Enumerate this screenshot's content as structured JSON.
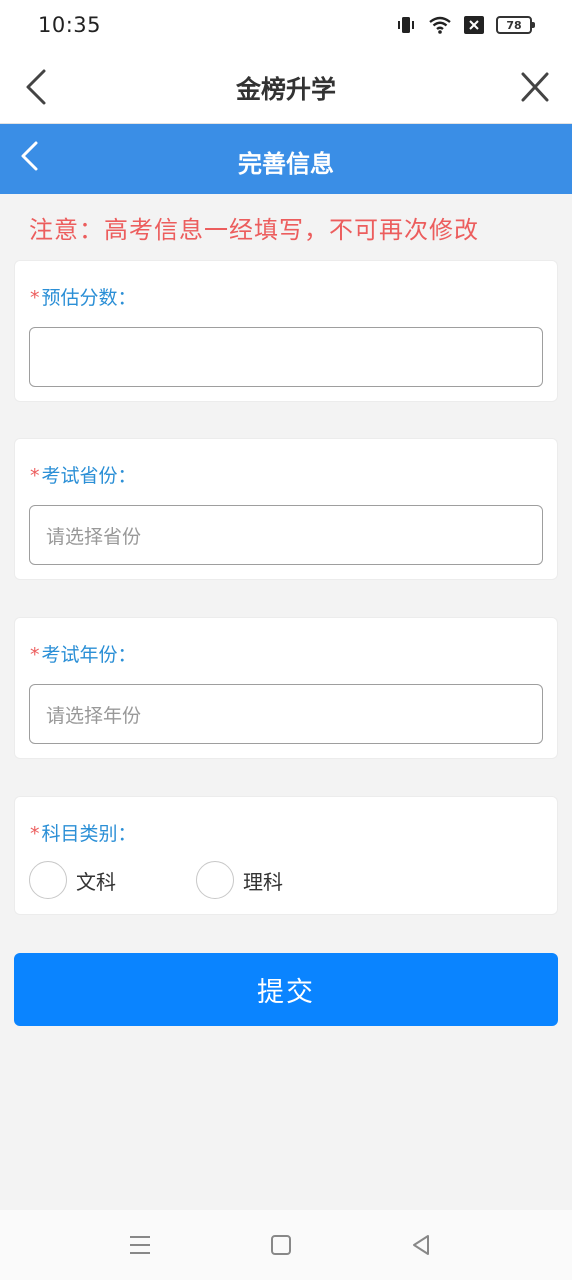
{
  "status_bar": {
    "time": "10:35",
    "battery": "78",
    "icons": [
      "vibrate-icon",
      "wifi-icon",
      "sim-x-icon",
      "battery-icon"
    ]
  },
  "app_nav": {
    "title": "金榜升学",
    "icons": [
      "back-icon",
      "close-icon"
    ]
  },
  "page_header": {
    "title": "完善信息",
    "background": "#3a8ee6"
  },
  "notice": "注意：高考信息一经填写，不可再次修改",
  "form": {
    "required_mark": "*",
    "score": {
      "label": "预估分数：",
      "value": "",
      "placeholder": ""
    },
    "province": {
      "label": "考试省份：",
      "value": "",
      "placeholder": "请选择省份"
    },
    "year": {
      "label": "考试年份：",
      "value": "",
      "placeholder": "请选择年份"
    },
    "subject": {
      "label": "科目类别：",
      "options": [
        "文科",
        "理科"
      ],
      "selected": null
    }
  },
  "submit_label": "提交",
  "colors": {
    "accent": "#0a84ff",
    "label": "#2b8fd6",
    "warning": "#ec5d5d"
  },
  "bottom_nav": {
    "icons": [
      "menu-icon",
      "home-icon",
      "back-triangle-icon"
    ]
  }
}
